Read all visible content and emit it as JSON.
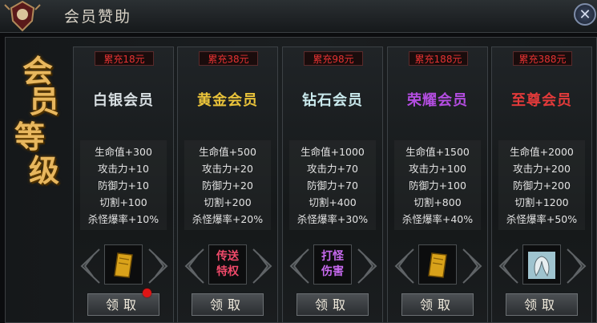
{
  "header": {
    "title": "会员赞助",
    "close_icon": "close-icon"
  },
  "side_label": [
    "会",
    "员",
    "等",
    "级"
  ],
  "tiers": [
    {
      "recharge": "累充18元",
      "name": "白银会员",
      "name_color": "#d8dfe2",
      "stats": [
        "生命值+300",
        "攻击力+10",
        "防御力+10",
        "切割+100",
        "杀怪爆率+10%"
      ],
      "reward": {
        "type": "icon",
        "icon": "book-icon",
        "text": []
      },
      "button": "领取",
      "has_notification": true
    },
    {
      "recharge": "累充38元",
      "name": "黄金会员",
      "name_color": "#e8c23a",
      "stats": [
        "生命值+500",
        "攻击力+20",
        "防御力+20",
        "切割+200",
        "杀怪爆率+20%"
      ],
      "reward": {
        "type": "text",
        "icon": "",
        "text": [
          "传送",
          "特权"
        ],
        "color": "#f04a6a"
      },
      "button": "领取",
      "has_notification": false
    },
    {
      "recharge": "累充98元",
      "name": "钻石会员",
      "name_color": "#c9e9ec",
      "stats": [
        "生命值+1000",
        "攻击力+70",
        "防御力+70",
        "切割+400",
        "杀怪爆率+30%"
      ],
      "reward": {
        "type": "text",
        "icon": "",
        "text": [
          "打怪",
          "伤害"
        ],
        "color": "#c86af0"
      },
      "button": "领取",
      "has_notification": false
    },
    {
      "recharge": "累充188元",
      "name": "荣耀会员",
      "name_color": "#b34de0",
      "stats": [
        "生命值+1500",
        "攻击力+100",
        "防御力+100",
        "切割+800",
        "杀怪爆率+40%"
      ],
      "reward": {
        "type": "icon",
        "icon": "book-icon",
        "text": []
      },
      "button": "领取",
      "has_notification": false
    },
    {
      "recharge": "累充388元",
      "name": "至尊会员",
      "name_color": "#e23a3a",
      "stats": [
        "生命值+2000",
        "攻击力+200",
        "防御力+200",
        "切割+1200",
        "杀怪爆率+50%"
      ],
      "reward": {
        "type": "icon",
        "icon": "wings-icon",
        "text": []
      },
      "button": "领取",
      "has_notification": false
    }
  ]
}
